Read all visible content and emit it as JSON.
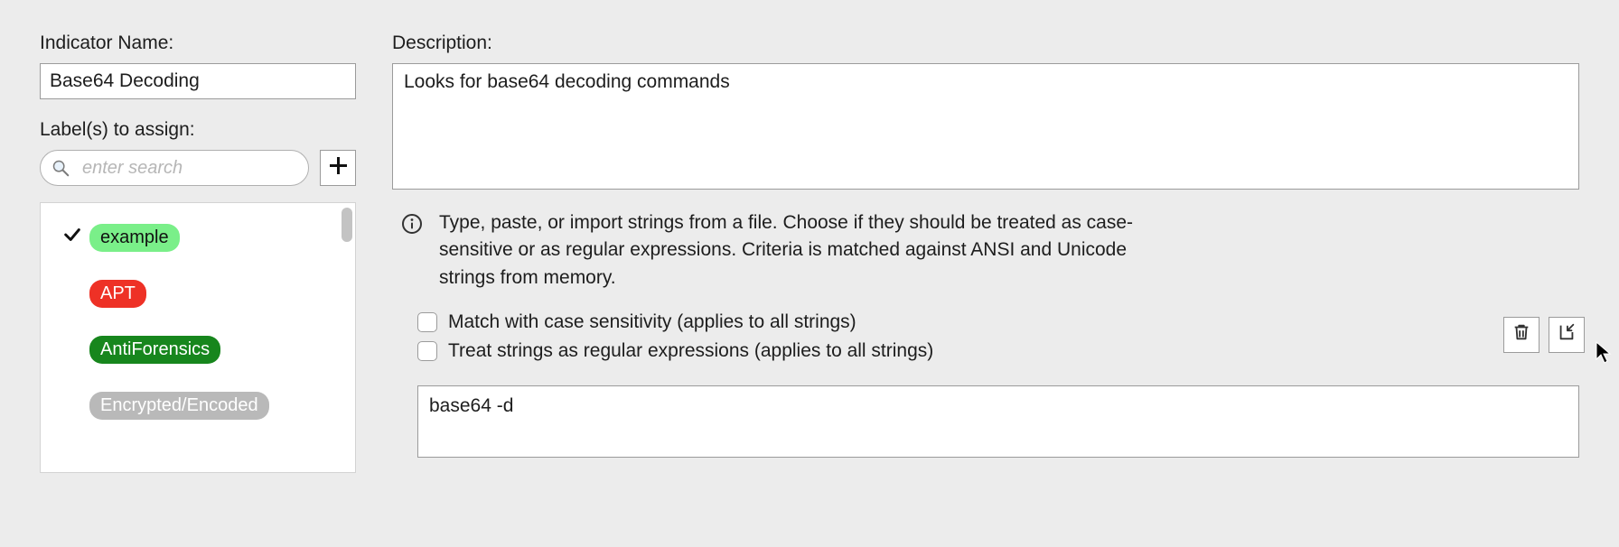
{
  "indicator_name": {
    "label": "Indicator Name:",
    "value": "Base64 Decoding"
  },
  "labels_assign": {
    "label": "Label(s) to assign:",
    "search_placeholder": "enter search",
    "items": [
      {
        "text": "example",
        "checked": true,
        "pill_class": "pill-example"
      },
      {
        "text": "APT",
        "checked": false,
        "pill_class": "pill-apt"
      },
      {
        "text": "AntiForensics",
        "checked": false,
        "pill_class": "pill-antiforensics"
      },
      {
        "text": "Encrypted/Encoded",
        "checked": false,
        "pill_class": "pill-encrypted"
      }
    ]
  },
  "description": {
    "label": "Description:",
    "value": "Looks for base64 decoding commands"
  },
  "info_text": "Type, paste, or import strings from a file. Choose if they should be treated as case-sensitive or as regular expressions. Criteria is matched against ANSI and Unicode strings from memory.",
  "options": {
    "case_sensitive": "Match with case sensitivity (applies to all strings)",
    "regex": "Treat strings as regular expressions (applies to all strings)"
  },
  "strings_value": "base64 -d"
}
